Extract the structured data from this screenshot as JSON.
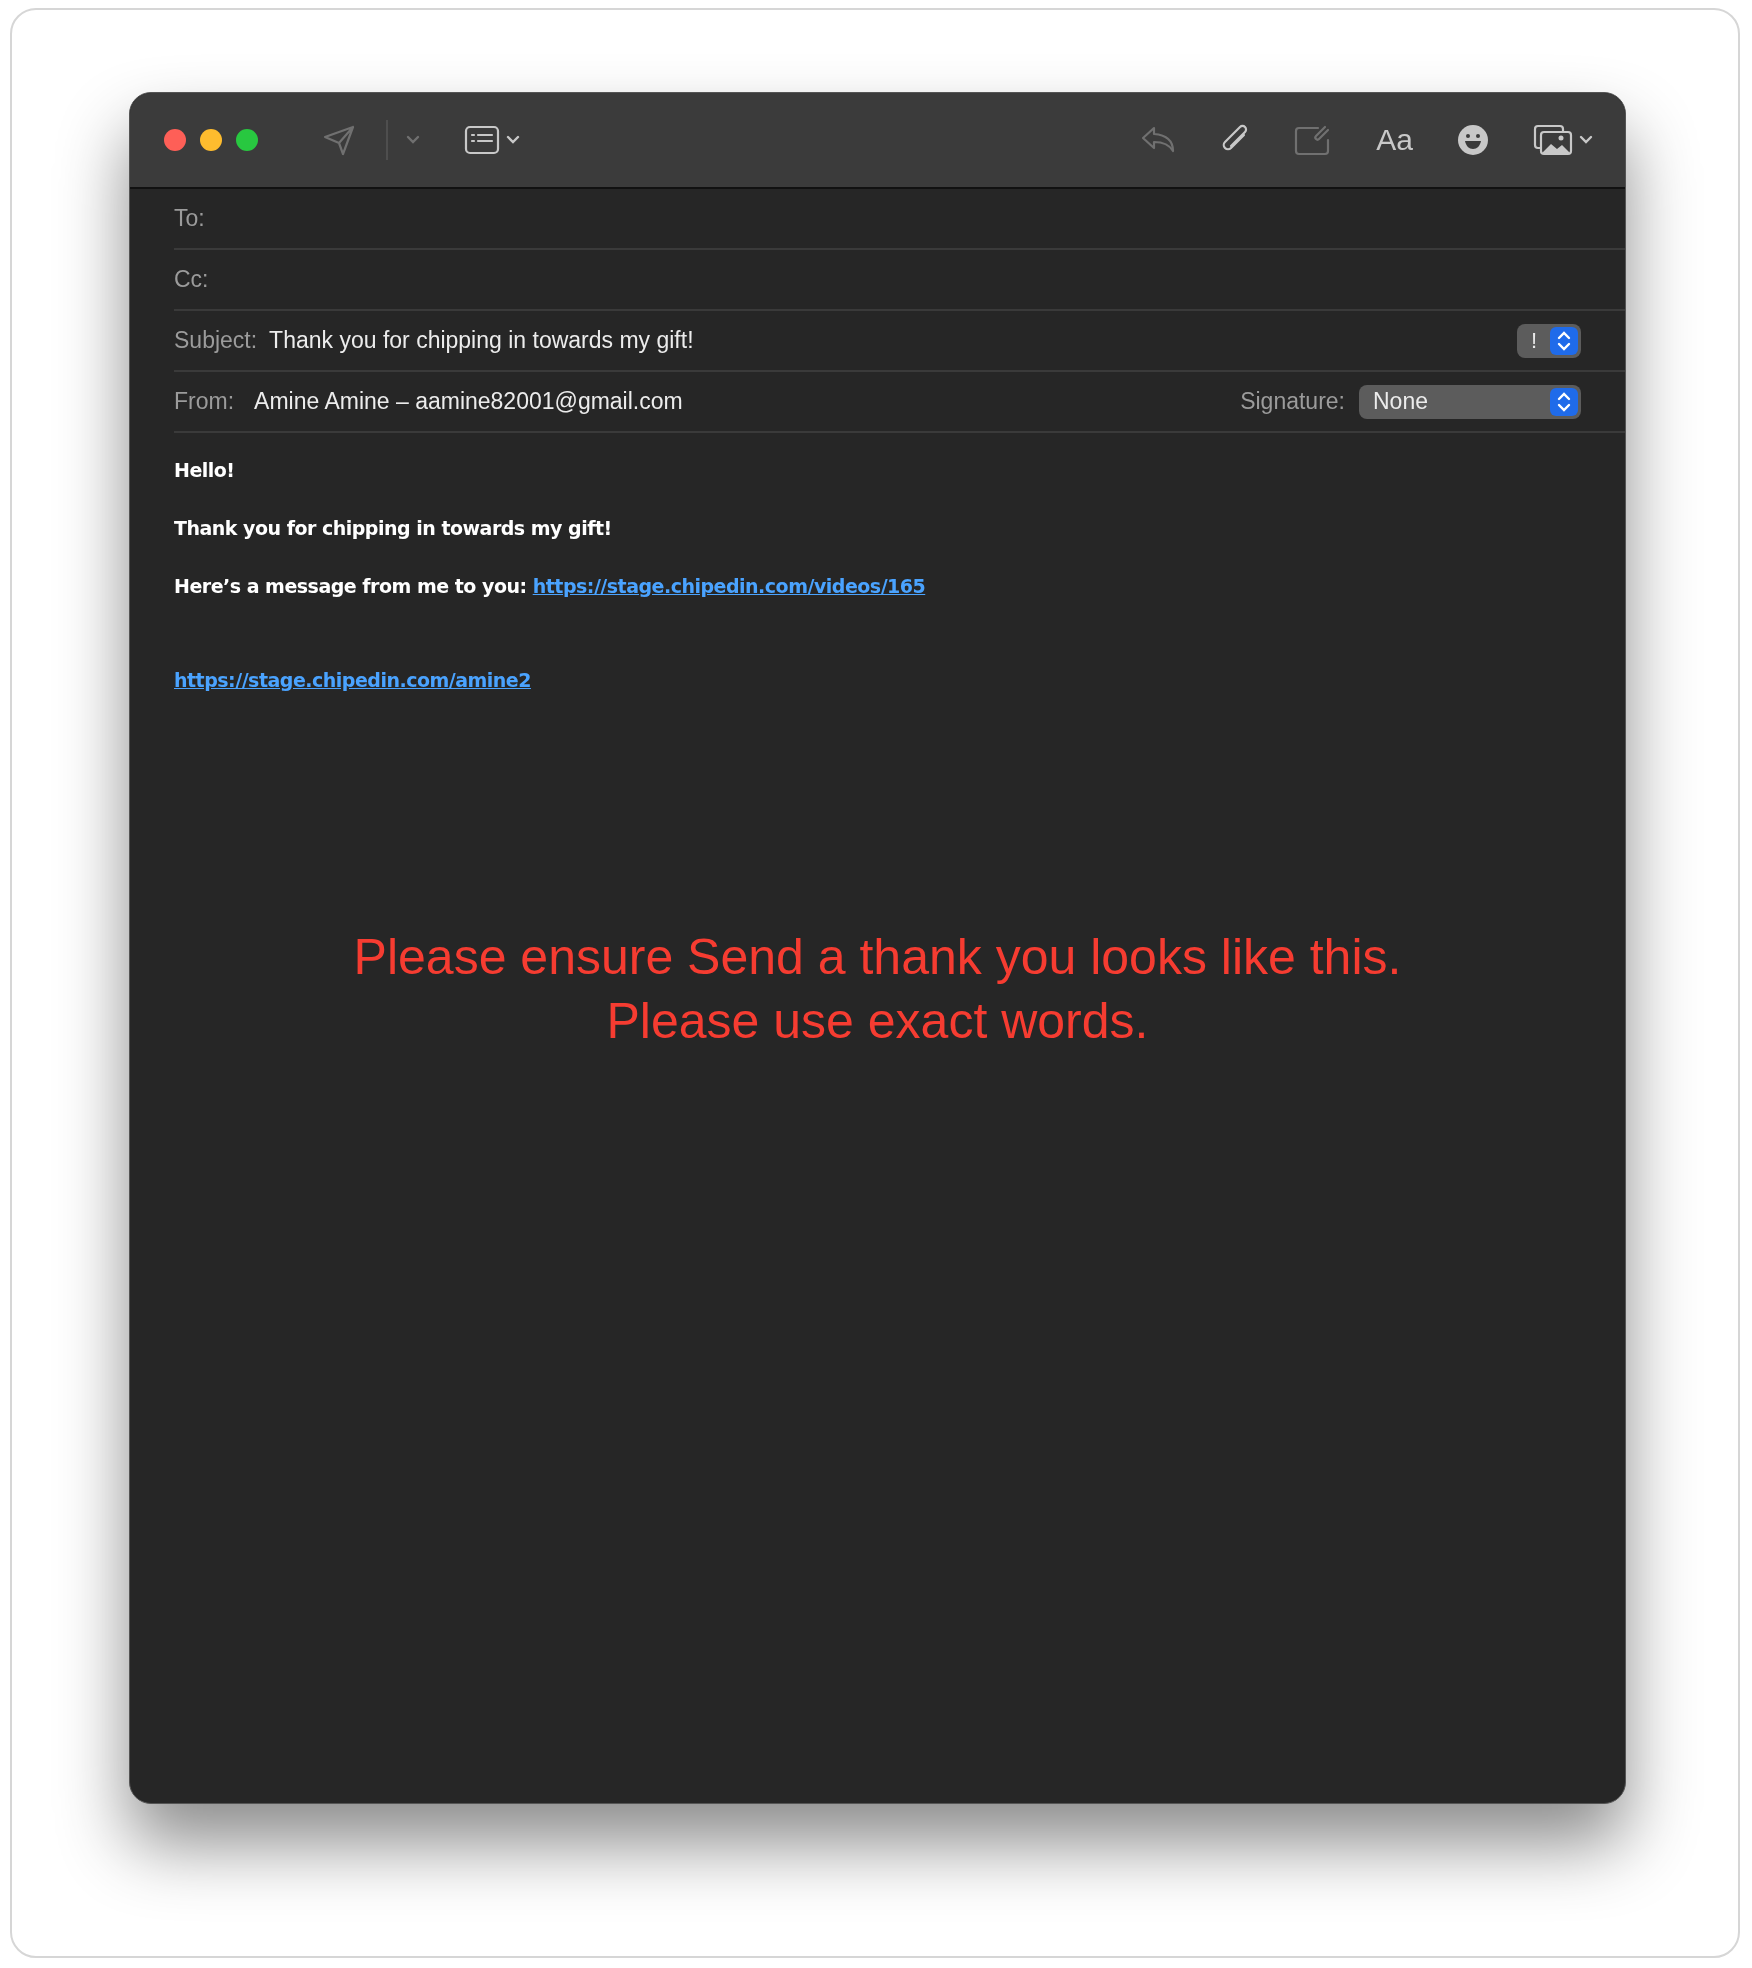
{
  "window": {
    "controls": [
      {
        "color": "#fe5f57"
      },
      {
        "color": "#febc2e"
      },
      {
        "color": "#28c840"
      }
    ]
  },
  "toolbar": {
    "left": [
      {
        "kind": "send",
        "disabled": true
      },
      {
        "kind": "send-menu",
        "disabled": true
      },
      {
        "kind": "header-fields",
        "disabled": false
      }
    ],
    "right": [
      {
        "kind": "reply",
        "disabled": true
      },
      {
        "kind": "attach",
        "disabled": false
      },
      {
        "kind": "attach-box",
        "disabled": true
      },
      {
        "kind": "format",
        "label": "Aa",
        "disabled": false
      },
      {
        "kind": "emoji",
        "disabled": false
      },
      {
        "kind": "photo",
        "disabled": false
      }
    ]
  },
  "fields": [
    {
      "kind": "plain",
      "label": "To:"
    },
    {
      "kind": "plain",
      "label": "Cc:"
    },
    {
      "kind": "subject",
      "label": "Subject:",
      "value": "Thank you for chipping in towards my gift!",
      "priority": "!"
    },
    {
      "kind": "from",
      "label": "From:",
      "value": "Amine Amine – aamine82001@gmail.com",
      "signature_label": "Signature:",
      "signature": "None"
    }
  ],
  "body": [
    {
      "kind": "text",
      "parts": [
        {
          "text": "Hello!"
        }
      ]
    },
    {
      "kind": "text",
      "parts": [
        {
          "text": "Thank you for chipping in towards my gift!"
        }
      ]
    },
    {
      "kind": "text",
      "parts": [
        {
          "text": "Here’s a message from me to you: "
        },
        {
          "text": "https://stage.chipedin.com/videos/165",
          "link": true
        }
      ]
    },
    {
      "kind": "blank"
    },
    {
      "kind": "text",
      "parts": [
        {
          "text": "https://stage.chipedin.com/amine2",
          "link": true
        }
      ]
    }
  ],
  "note": [
    "Please ensure Send a thank you looks like this.",
    "Please use exact words."
  ]
}
